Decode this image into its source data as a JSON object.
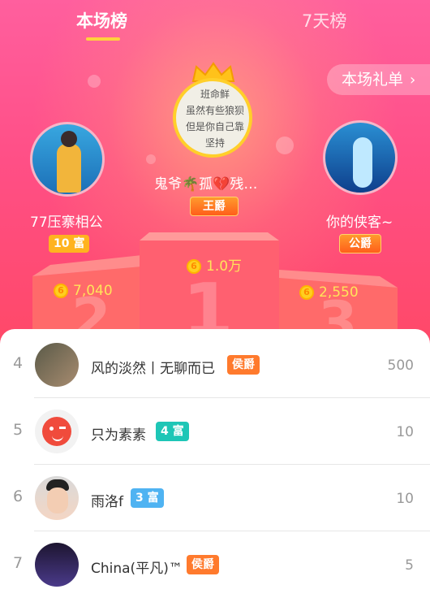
{
  "tabs": [
    {
      "label": "本场榜",
      "active": true
    },
    {
      "label": "7天榜",
      "active": false
    }
  ],
  "gift_list_button": {
    "label": "本场礼单",
    "icon": "chevron-right-icon"
  },
  "podium": {
    "first": {
      "name": "鬼爷🌴孤💔残…",
      "badge": "王爵",
      "score": "1.0万",
      "rank": "1",
      "avatar_text": [
        "班命鲜",
        "虽然有些狼狈",
        "但是你自己靠",
        "坚持"
      ]
    },
    "second": {
      "name": "77压寨相公",
      "badge_num": "10",
      "badge_text": "富",
      "score": "7,040",
      "rank": "2"
    },
    "third": {
      "name": "你的侠客~",
      "badge": "公爵",
      "score": "2,550",
      "rank": "3"
    }
  },
  "list": [
    {
      "rank": "4",
      "name": "风的淡然丨无聊而已",
      "tag": "侯爵",
      "tag_color": "#ff7a2d",
      "value": "500"
    },
    {
      "rank": "5",
      "name": "只为素素",
      "tag": "4 富",
      "tag_color": "#1ec6b6",
      "value": "10"
    },
    {
      "rank": "6",
      "name": "雨洛f",
      "tag": "3 富",
      "tag_color": "#4fb3f2",
      "value": "10"
    },
    {
      "rank": "7",
      "name": "China(平凡)™",
      "tag": "侯爵",
      "tag_color": "#ff7a2d",
      "value": "5"
    }
  ],
  "coin_glyph": "6",
  "colors": {
    "hero_top": "#ff5f9e",
    "hero_bottom": "#ff4866",
    "accent_yellow": "#ffd23c",
    "rich_badge": "#ffb31f"
  }
}
